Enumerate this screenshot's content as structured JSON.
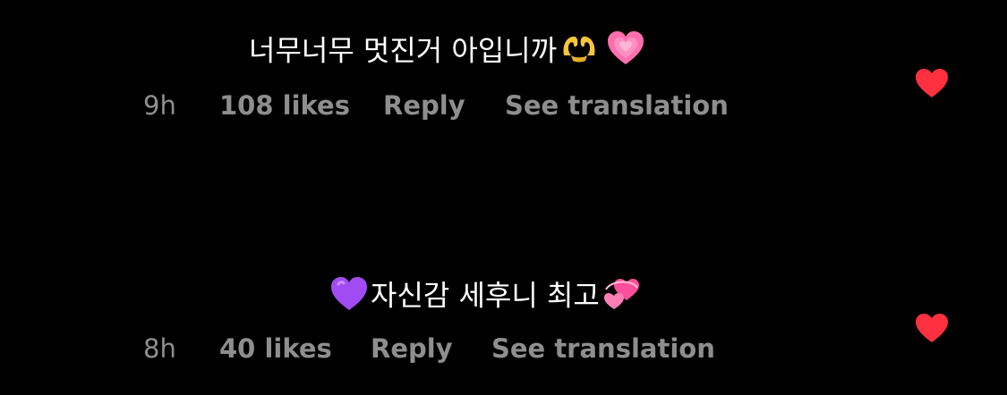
{
  "comments": [
    {
      "text": "너무너무 멋진거 아입니까",
      "trailing_emojis": [
        "heart-hands-emoji",
        "growing-heart-emoji"
      ],
      "time": "9h",
      "likes": "108 likes",
      "reply_label": "Reply",
      "translate_label": "See translation",
      "liked": true
    },
    {
      "leading_emoji": "purple-heart-emoji",
      "text": "자신감 세후니 최고",
      "trailing_emojis": [
        "revolving-hearts-emoji"
      ],
      "time": "8h",
      "likes": "40 likes",
      "reply_label": "Reply",
      "translate_label": "See translation",
      "liked": true
    }
  ],
  "colors": {
    "background": "#000000",
    "text": "#ffffff",
    "meta": "#8e8e8e",
    "like": "#ff3040",
    "yellow_emoji": "#f7c63a",
    "pink_emoji": "#ff6fae",
    "purple_emoji": "#a14cf2"
  }
}
